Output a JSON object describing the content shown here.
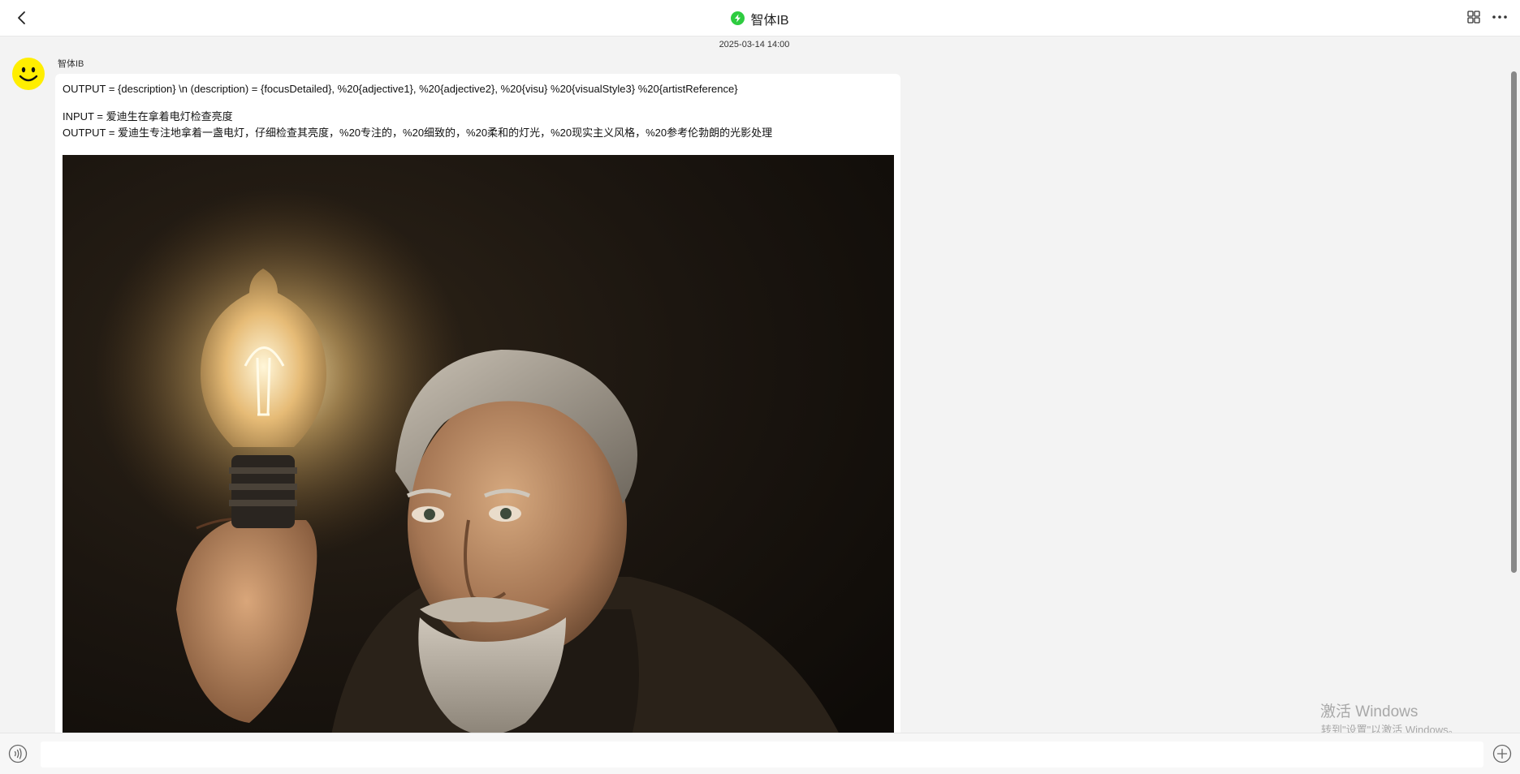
{
  "header": {
    "title": "智体IB",
    "back_icon": "chevron-left-icon",
    "badge_icon": "lightning-icon",
    "badge_color": "#2ecc40",
    "grid_icon": "grid-icon",
    "more_icon": "more-horizontal-icon"
  },
  "chat": {
    "timestamp": "2025-03-14 14:00",
    "sender_name": "智体IB",
    "avatar_icon": "smiley-face-icon",
    "avatar_color": "#ffee00",
    "message": {
      "line1": "OUTPUT = {description} \\n  (description) = {focusDetailed}, %20{adjective1}, %20{adjective2}, %20{visu} %20{visualStyle3} %20{artistReference}",
      "line2": "INPUT = 爱迪生在拿着电灯检查亮度",
      "line3": "OUTPUT = 爱迪生专注地拿着一盏电灯，仔细检查其亮度，%20专注的，%20细致的，%20柔和的灯光，%20现实主义风格，%20参考伦勃朗的光影处理",
      "image_subject": "elderly man with white beard holding a glowing light bulb"
    }
  },
  "watermark": {
    "title": "激活 Windows",
    "subtitle": "转到\"设置\"以激活 Windows。"
  },
  "composer": {
    "voice_icon": "voice-icon",
    "input_value": "",
    "plus_icon": "plus-circle-icon"
  }
}
